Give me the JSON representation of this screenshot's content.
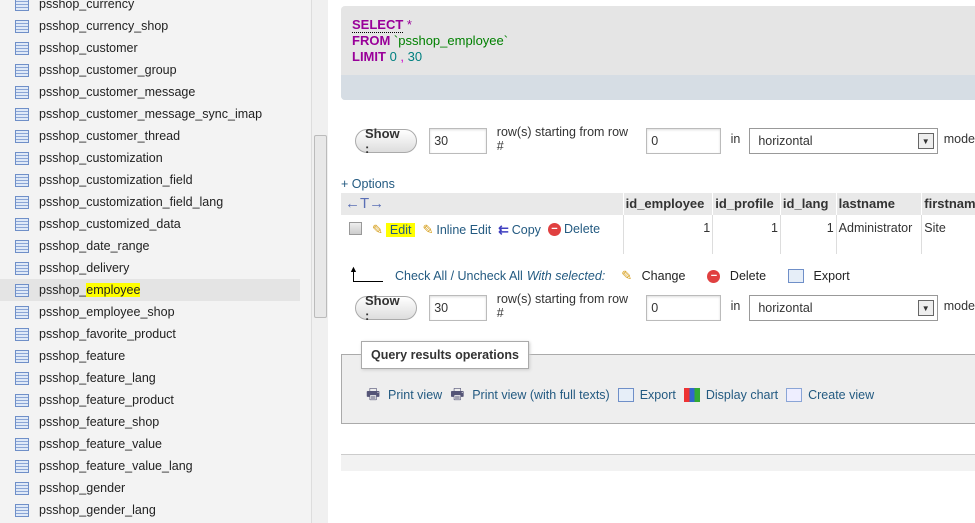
{
  "sidebar": {
    "items": [
      {
        "label": "psshop_currency"
      },
      {
        "label": "psshop_currency_shop"
      },
      {
        "label": "psshop_customer"
      },
      {
        "label": "psshop_customer_group"
      },
      {
        "label": "psshop_customer_message"
      },
      {
        "label": "psshop_customer_message_sync_imap"
      },
      {
        "label": "psshop_customer_thread"
      },
      {
        "label": "psshop_customization"
      },
      {
        "label": "psshop_customization_field"
      },
      {
        "label": "psshop_customization_field_lang"
      },
      {
        "label": "psshop_customized_data"
      },
      {
        "label": "psshop_date_range"
      },
      {
        "label": "psshop_delivery"
      },
      {
        "label": "psshop_employee",
        "prefix": "psshop_",
        "highlight": "employee",
        "active": true
      },
      {
        "label": "psshop_employee_shop"
      },
      {
        "label": "psshop_favorite_product"
      },
      {
        "label": "psshop_feature"
      },
      {
        "label": "psshop_feature_lang"
      },
      {
        "label": "psshop_feature_product"
      },
      {
        "label": "psshop_feature_shop"
      },
      {
        "label": "psshop_feature_value"
      },
      {
        "label": "psshop_feature_value_lang"
      },
      {
        "label": "psshop_gender"
      },
      {
        "label": "psshop_gender_lang"
      }
    ]
  },
  "sql": {
    "select": "SELECT",
    "star": "*",
    "from": "FROM",
    "table": "`psshop_employee`",
    "limit": "LIMIT",
    "offset": "0",
    "comma": ",",
    "count": "30"
  },
  "nav": {
    "show_label": "Show :",
    "rows": "30",
    "starting_text": "row(s) starting from row #",
    "start": "0",
    "in_text": "in",
    "mode": "horizontal",
    "mode_suffix": "mode"
  },
  "options_label": "+ Options",
  "table": {
    "columns": [
      "id_employee",
      "id_profile",
      "id_lang",
      "lastname",
      "firstnam"
    ],
    "row": {
      "actions": {
        "edit": "Edit",
        "inline_edit": "Inline Edit",
        "copy": "Copy",
        "delete": "Delete"
      },
      "cells": [
        "1",
        "1",
        "1",
        "Administrator",
        "Site"
      ]
    }
  },
  "with_selected": {
    "check_all": "Check All / Uncheck All",
    "label": "With selected:",
    "change": "Change",
    "delete": "Delete",
    "export": "Export"
  },
  "operations": {
    "legend": "Query results operations",
    "items": [
      "Print view",
      "Print view (with full texts)",
      "Export",
      "Display chart",
      "Create view"
    ]
  },
  "colors": {
    "keyword": "#990099",
    "string": "#008000",
    "number": "#008080",
    "link": "#235a81",
    "highlight": "#ffff00"
  }
}
